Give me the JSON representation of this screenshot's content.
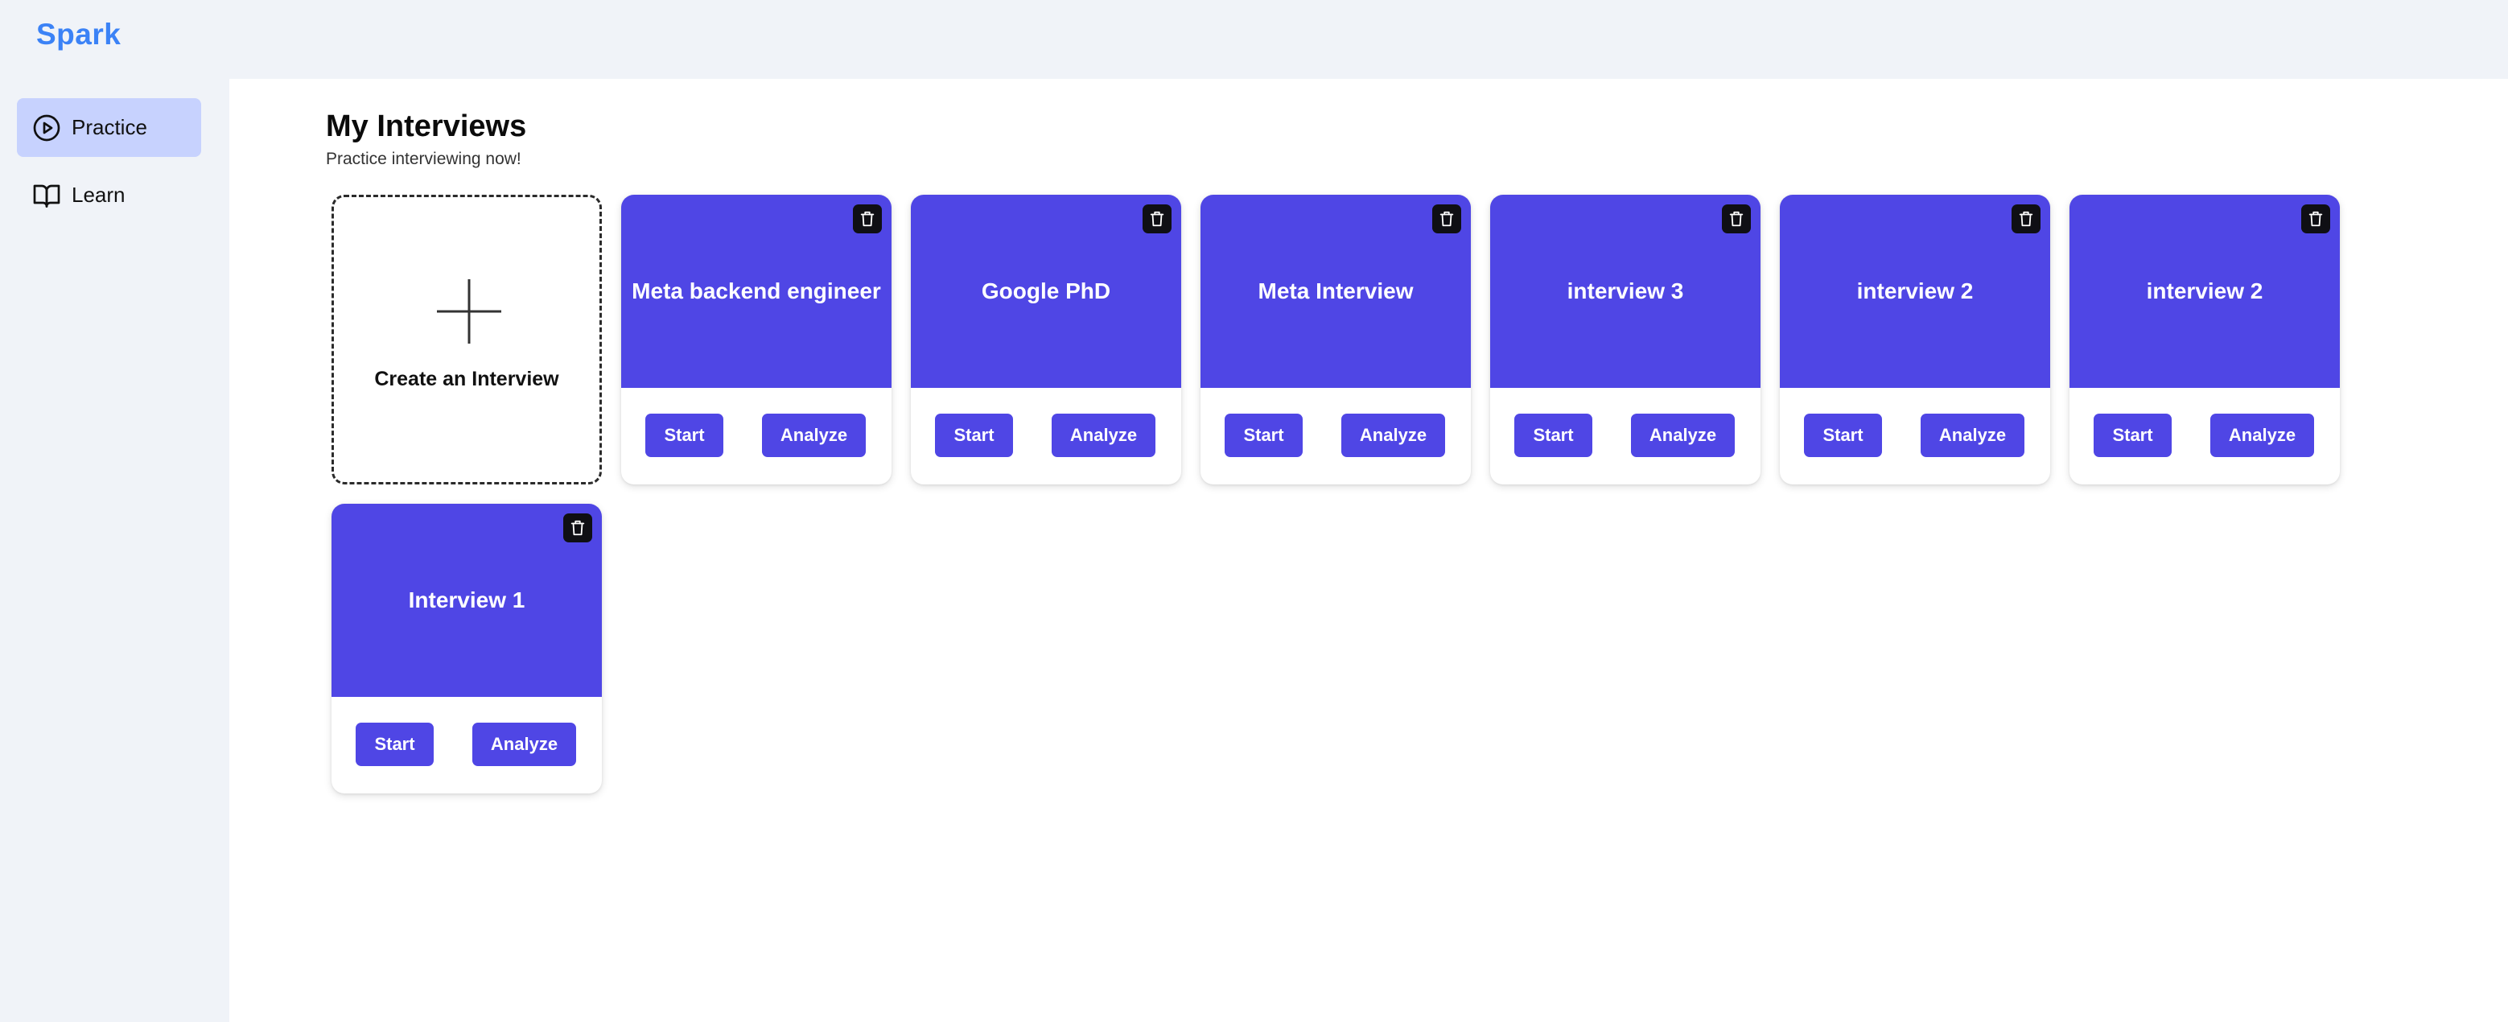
{
  "app": {
    "brand": "Spark"
  },
  "sidebar": {
    "items": [
      {
        "label": "Practice",
        "icon": "play-circle-icon",
        "active": true
      },
      {
        "label": "Learn",
        "icon": "book-open-icon",
        "active": false
      }
    ]
  },
  "main": {
    "title": "My Interviews",
    "subtitle": "Practice interviewing now!",
    "create_label": "Create an Interview",
    "start_label": "Start",
    "analyze_label": "Analyze",
    "interviews": [
      {
        "title": "Meta backend engineer"
      },
      {
        "title": "Google PhD"
      },
      {
        "title": "Meta Interview"
      },
      {
        "title": "interview 3"
      },
      {
        "title": "interview 2"
      },
      {
        "title": "interview 2"
      },
      {
        "title": "Interview 1"
      }
    ]
  },
  "colors": {
    "accent": "#4f46e5",
    "brand": "#3b82f6",
    "active_nav": "#c7d2fe",
    "background": "#f0f3f8"
  }
}
